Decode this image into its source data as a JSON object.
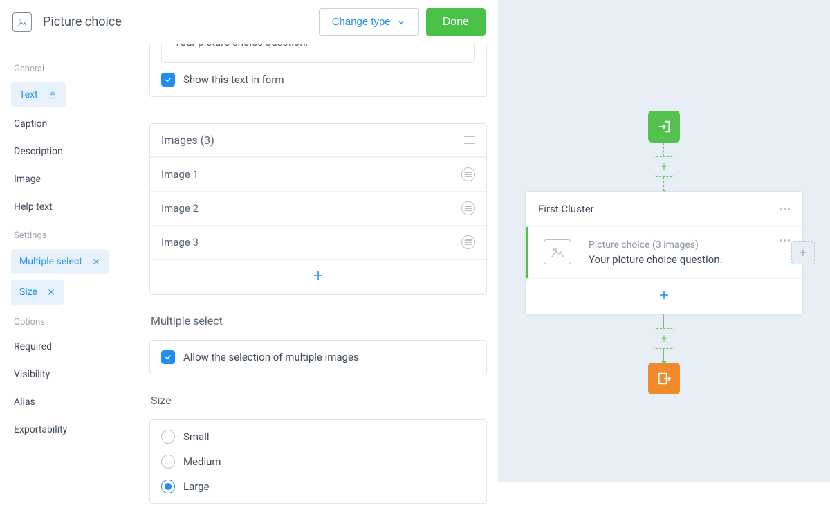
{
  "header": {
    "title": "Picture choice",
    "change_label": "Change type",
    "done_label": "Done"
  },
  "sidebar": {
    "groups": {
      "general": {
        "title": "General"
      },
      "settings": {
        "title": "Settings"
      },
      "options": {
        "title": "Options"
      }
    },
    "general_items": {
      "text": "Text",
      "caption": "Caption",
      "description": "Description",
      "image": "Image",
      "help_text": "Help text"
    },
    "settings_items": {
      "multiple_select": "Multiple select",
      "size": "Size"
    },
    "options_items": {
      "required": "Required",
      "visibility": "Visibility",
      "alias": "Alias",
      "exportability": "Exportability"
    }
  },
  "text_card": {
    "value": "Your picture choice question.",
    "show_label": "Show this text in form"
  },
  "images_card": {
    "header": "Images (3)",
    "rows": [
      "Image 1",
      "Image 2",
      "Image 3"
    ]
  },
  "multiple_select": {
    "title": "Multiple select",
    "checkbox_label": "Allow the selection of multiple images"
  },
  "size": {
    "title": "Size",
    "options": [
      "Small",
      "Medium",
      "Large"
    ],
    "selected": "Large"
  },
  "canvas": {
    "cluster_title": "First Cluster",
    "row_type": "Picture choice (3 images)",
    "row_text": "Your picture choice question."
  }
}
